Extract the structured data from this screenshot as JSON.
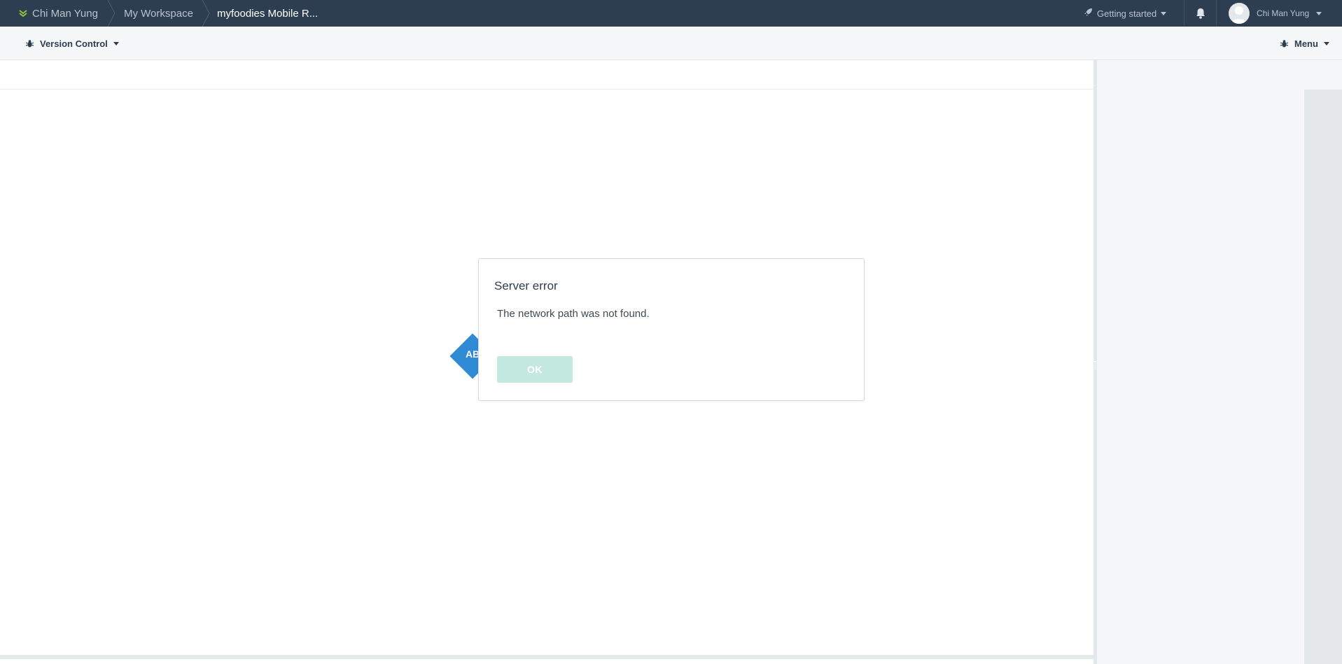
{
  "topbar": {
    "breadcrumbs": [
      "Chi Man Yung",
      "My Workspace",
      "myfoodies Mobile R..."
    ],
    "getting_started_label": "Getting started",
    "user_name": "Chi Man Yung",
    "logo_icon": "app-logo-icon",
    "bell_icon": "bell-icon"
  },
  "toolbar": {
    "version_control_label": "Version Control",
    "menu_label": "Menu",
    "icon": "bug-icon"
  },
  "canvas": {
    "node_label": "AB"
  },
  "dialog": {
    "title": "Server error",
    "message": "The network path was not found.",
    "ok_label": "OK"
  },
  "colors": {
    "topbar_bg": "#2d3e50",
    "accent_green": "#8dc63f",
    "node_blue": "#2f8bd6",
    "ok_button_disabled": "#c3e8df"
  }
}
